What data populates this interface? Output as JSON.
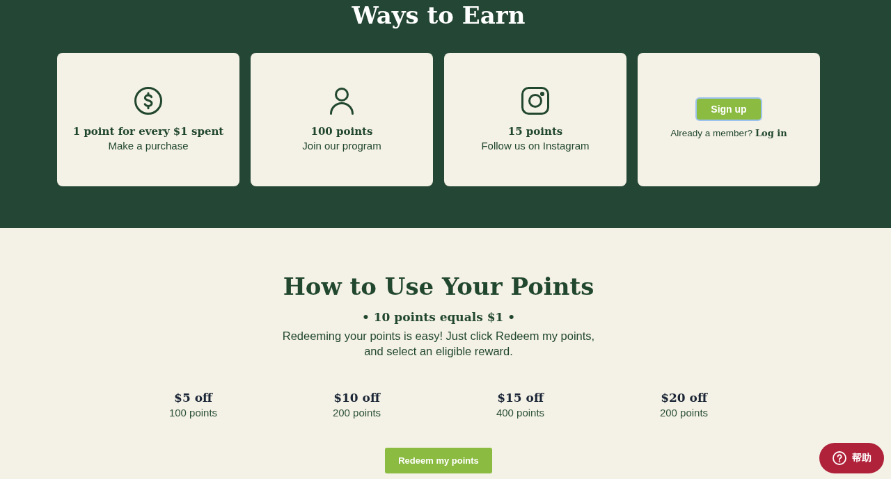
{
  "earn": {
    "title": "Ways to Earn",
    "cards": [
      {
        "kind": "purchase",
        "title": "1 point for every $1 spent",
        "subtitle": "Make a purchase"
      },
      {
        "kind": "join",
        "title": "100 points",
        "subtitle": "Join our program"
      },
      {
        "kind": "follow",
        "title": "15 points",
        "subtitle": "Follow us on Instagram"
      },
      {
        "kind": "signup",
        "button": {
          "label": "Sign up",
          "focused": true
        },
        "prompt": "Already a member?",
        "link": "Log in"
      }
    ]
  },
  "redeem": {
    "title": "How to Use Your Points",
    "rate": "• 10 points equals $1 •",
    "description": "Redeeming your points is easy! Just click Redeem my points, and select an eligible reward.",
    "rewards": [
      {
        "title": "$5 off",
        "points": "100 points"
      },
      {
        "title": "$10 off",
        "points": "200 points"
      },
      {
        "title": "$15 off",
        "points": "400 points"
      },
      {
        "title": "$20 off",
        "points": "200 points"
      }
    ],
    "button": {
      "label": "Redeem my points"
    }
  },
  "help_button": {
    "label": "帮助"
  }
}
